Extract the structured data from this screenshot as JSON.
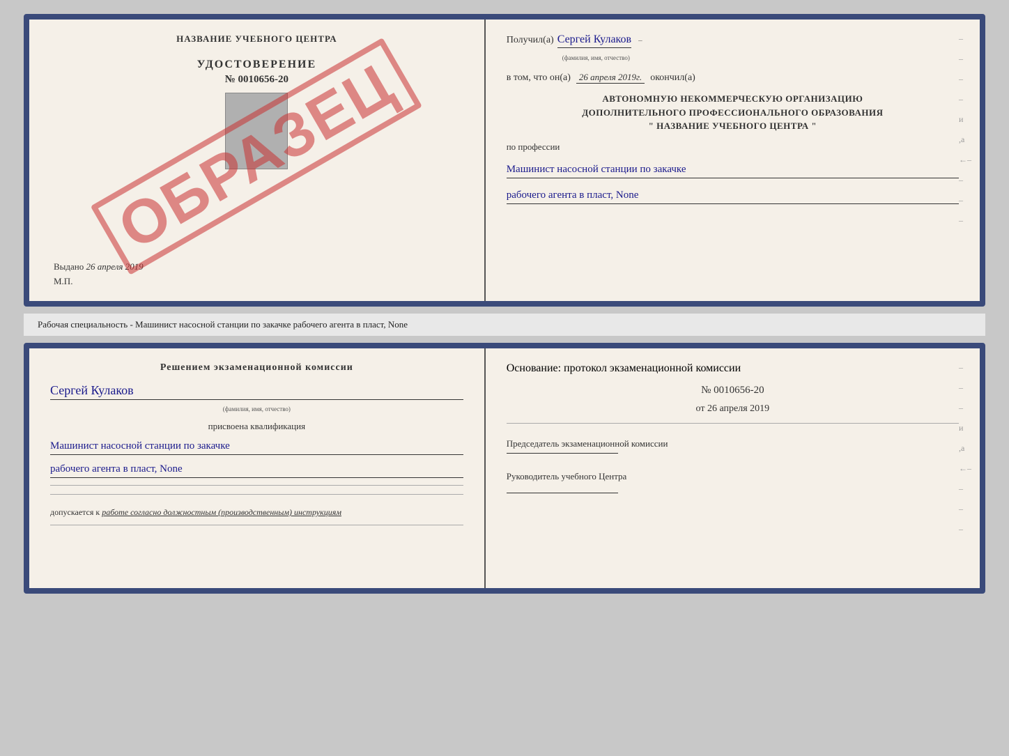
{
  "topLeft": {
    "centerTitle": "НАЗВАНИЕ УЧЕБНОГО ЦЕНТРА",
    "udostLabel": "УДОСТОВЕРЕНИЕ",
    "udostNumber": "№ 0010656-20",
    "vydanoLabel": "Выдано",
    "vydanoDate": "26 апреля 2019",
    "mpLabel": "М.П.",
    "watermark": "ОБРАЗЕЦ"
  },
  "topRight": {
    "poluchilLabel": "Получил(a)",
    "poluchilName": "Сергей Кулаков",
    "familiyaHint": "(фамилия, имя, отчество)",
    "vtomLabel": "в том, что он(а)",
    "vtomDate": "26 апреля 2019г.",
    "okonchilLabel": "окончил(а)",
    "orgLine1": "АВТОНОМНУЮ НЕКОММЕРЧЕСКУЮ ОРГАНИЗАЦИЮ",
    "orgLine2": "ДОПОЛНИТЕЛЬНОГО ПРОФЕССИОНАЛЬНОГО ОБРАЗОВАНИЯ",
    "orgLine3": "\"   НАЗВАНИЕ УЧЕБНОГО ЦЕНТРА   \"",
    "poProfessiiLabel": "по профессии",
    "profLine1": "Машинист насосной станции по закачке",
    "profLine2": "рабочего агента в пласт, None"
  },
  "middleText": {
    "text": "Рабочая специальность - Машинист насосной станции по закачке рабочего агента в пласт, None"
  },
  "bottomLeft": {
    "resheniemTitle": "Решением экзаменационной комиссии",
    "name": "Сергей Кулаков",
    "familiyaHint": "(фамилия, имя, отчество)",
    "prisvoenaLabel": "присвоена квалификация",
    "qualLine1": "Машинист насосной станции по закачке",
    "qualLine2": "рабочего агента в пласт, None",
    "dopuskaetsyaLabel": "допускается к",
    "dopuskaetsyaValue": "работе согласно должностным (производственным) инструкциям"
  },
  "bottomRight": {
    "osnovaniLabel": "Основание: протокол экзаменационной комиссии",
    "protocolNumber": "№ 0010656-20",
    "otDate": "от 26 апреля 2019",
    "predsedatelLabel": "Председатель экзаменационной комиссии",
    "rukovoditelLabel": "Руководитель учебного Центра"
  }
}
